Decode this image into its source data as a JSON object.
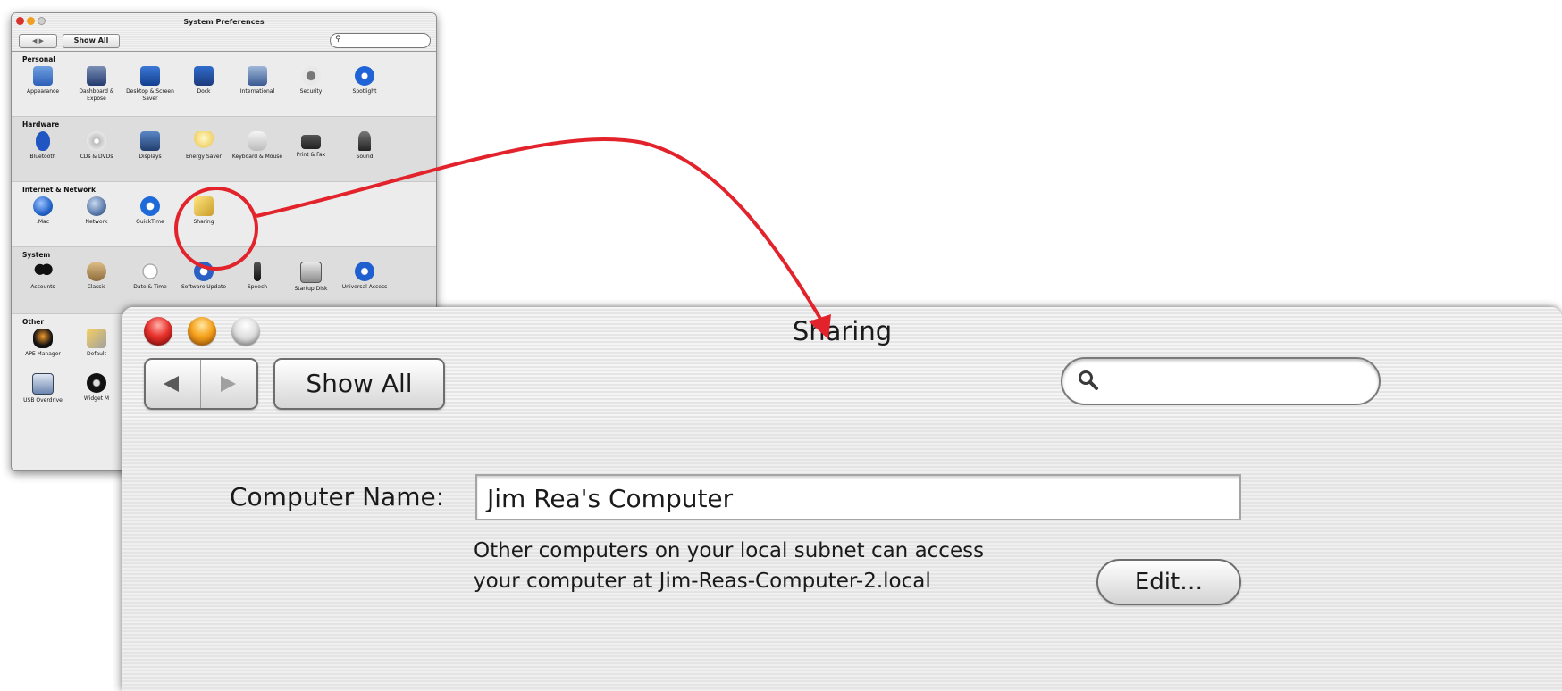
{
  "colors": {
    "annotation": "#e3232c"
  },
  "prefs_window": {
    "title": "System Preferences",
    "show_all": "Show All",
    "sections": [
      {
        "title": "Personal",
        "items": [
          {
            "label": "Appearance",
            "icon": "appearance-icon"
          },
          {
            "label": "Dashboard & Exposé",
            "icon": "dashboard-expose-icon"
          },
          {
            "label": "Desktop & Screen Saver",
            "icon": "desktop-screensaver-icon"
          },
          {
            "label": "Dock",
            "icon": "dock-icon"
          },
          {
            "label": "International",
            "icon": "international-icon"
          },
          {
            "label": "Security",
            "icon": "security-icon"
          },
          {
            "label": "Spotlight",
            "icon": "spotlight-icon"
          }
        ]
      },
      {
        "title": "Hardware",
        "items": [
          {
            "label": "Bluetooth",
            "icon": "bluetooth-icon"
          },
          {
            "label": "CDs & DVDs",
            "icon": "cd-dvd-icon"
          },
          {
            "label": "Displays",
            "icon": "displays-icon"
          },
          {
            "label": "Energy Saver",
            "icon": "energy-saver-icon"
          },
          {
            "label": "Keyboard & Mouse",
            "icon": "keyboard-mouse-icon"
          },
          {
            "label": "Print & Fax",
            "icon": "print-fax-icon"
          },
          {
            "label": "Sound",
            "icon": "sound-icon"
          }
        ]
      },
      {
        "title": "Internet & Network",
        "items": [
          {
            "label": ".Mac",
            "icon": "dotmac-icon"
          },
          {
            "label": "Network",
            "icon": "network-icon"
          },
          {
            "label": "QuickTime",
            "icon": "quicktime-icon"
          },
          {
            "label": "Sharing",
            "icon": "sharing-icon"
          }
        ]
      },
      {
        "title": "System",
        "items": [
          {
            "label": "Accounts",
            "icon": "accounts-icon"
          },
          {
            "label": "Classic",
            "icon": "classic-icon"
          },
          {
            "label": "Date & Time",
            "icon": "date-time-icon"
          },
          {
            "label": "Software Update",
            "icon": "software-update-icon"
          },
          {
            "label": "Speech",
            "icon": "speech-icon"
          },
          {
            "label": "Startup Disk",
            "icon": "startup-disk-icon"
          },
          {
            "label": "Universal Access",
            "icon": "universal-access-icon"
          }
        ]
      },
      {
        "title": "Other",
        "items": [
          {
            "label": "APE Manager",
            "icon": "ape-manager-icon"
          },
          {
            "label": "Default",
            "icon": "default-icon"
          },
          {
            "label": "USB Overdrive",
            "icon": "usb-overdrive-icon"
          },
          {
            "label": "Widget M",
            "icon": "widget-manager-icon"
          }
        ]
      }
    ]
  },
  "sharing_window": {
    "title": "Sharing",
    "show_all": "Show All",
    "search_placeholder": "",
    "computer_name_label": "Computer Name:",
    "computer_name_value": "Jim Rea's Computer",
    "info_line1": "Other computers on your local subnet can access",
    "info_line2": "your computer at Jim-Reas-Computer-2.local",
    "edit_button": "Edit…"
  }
}
